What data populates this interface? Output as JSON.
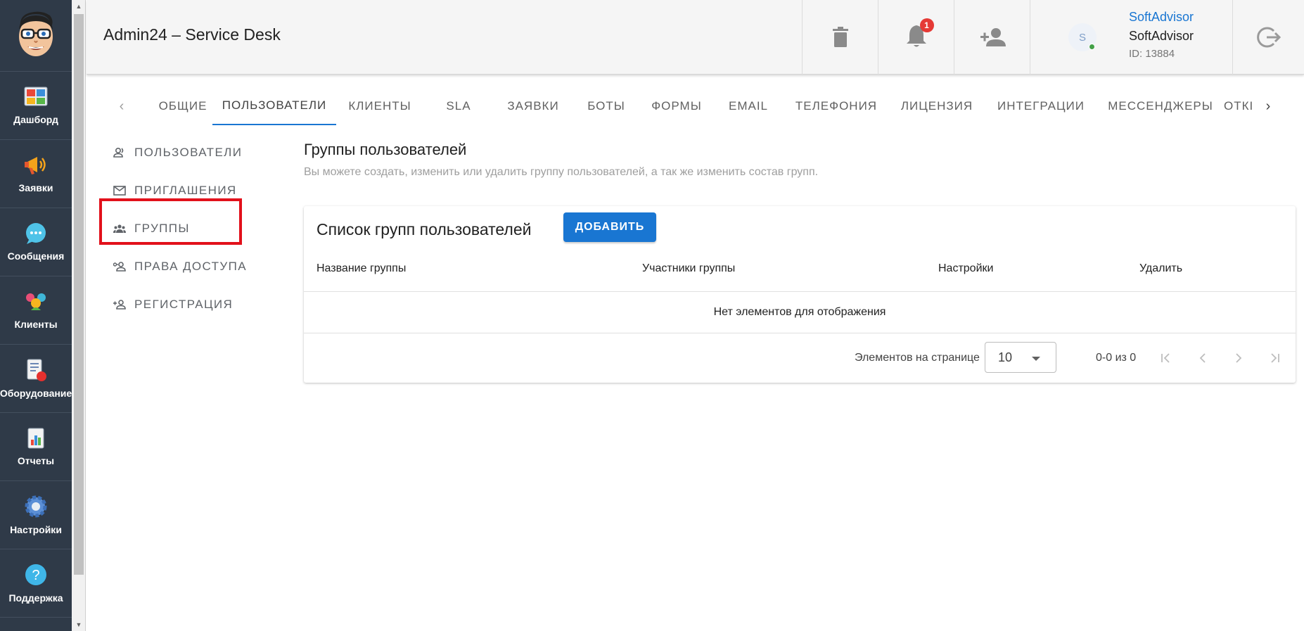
{
  "app": {
    "nav": [
      {
        "label": "Дашборд",
        "icon": "dashboard-icon"
      },
      {
        "label": "Заявки",
        "icon": "megaphone-icon"
      },
      {
        "label": "Сообщения",
        "icon": "chat-bubble-icon"
      },
      {
        "label": "Клиенты",
        "icon": "clients-icon"
      },
      {
        "label": "Оборудование",
        "icon": "equipment-icon"
      },
      {
        "label": "Отчеты",
        "icon": "reports-icon"
      },
      {
        "label": "Настройки",
        "icon": "gear-icon"
      },
      {
        "label": "Поддержка",
        "icon": "help-icon"
      }
    ]
  },
  "header": {
    "title": "Admin24 – Service Desk",
    "notifications_count": "1",
    "avatar_letter": "S",
    "user_name_link": "SoftAdvisor",
    "user_name": "SoftAdvisor",
    "user_id": "ID: 13884"
  },
  "tabs": [
    "ОБЩИЕ",
    "ПОЛЬЗОВАТЕЛИ",
    "КЛИЕНТЫ",
    "SLA",
    "ЗАЯВКИ",
    "БОТЫ",
    "ФОРМЫ",
    "EMAIL",
    "ТЕЛЕФОНИЯ",
    "ЛИЦЕНЗИЯ",
    "ИНТЕГРАЦИИ",
    "МЕССЕНДЖЕРЫ",
    "ОТКІ"
  ],
  "active_tab": "ПОЛЬЗОВАТЕЛИ",
  "subnav": [
    {
      "label": "ПОЛЬЗОВАТЕЛИ",
      "icon": "users-icon"
    },
    {
      "label": "ПРИГЛАШЕНИЯ",
      "icon": "mail-icon"
    },
    {
      "label": "ГРУППЫ",
      "icon": "groups-icon"
    },
    {
      "label": "ПРАВА ДОСТУПА",
      "icon": "access-rights-icon"
    },
    {
      "label": "РЕГИСТРАЦИЯ",
      "icon": "add-person-icon"
    }
  ],
  "content": {
    "heading": "Группы пользователей",
    "description": "Вы можете создать, изменить или удалить группу пользователей, а так же изменить состав групп.",
    "card_title": "Список групп пользователей",
    "add_button": "ДОБАВИТЬ",
    "columns": [
      "Название группы",
      "Участники группы",
      "Настройки",
      "Удалить"
    ],
    "empty_text": "Нет элементов для отображения",
    "per_page_label": "Элементов на странице",
    "per_page_value": "10",
    "range_text": "0-0 из 0"
  },
  "colors": {
    "sidebar": "#2f3a48",
    "accent": "#1976d2",
    "highlight": "#e2111b",
    "badge": "#e53935"
  }
}
